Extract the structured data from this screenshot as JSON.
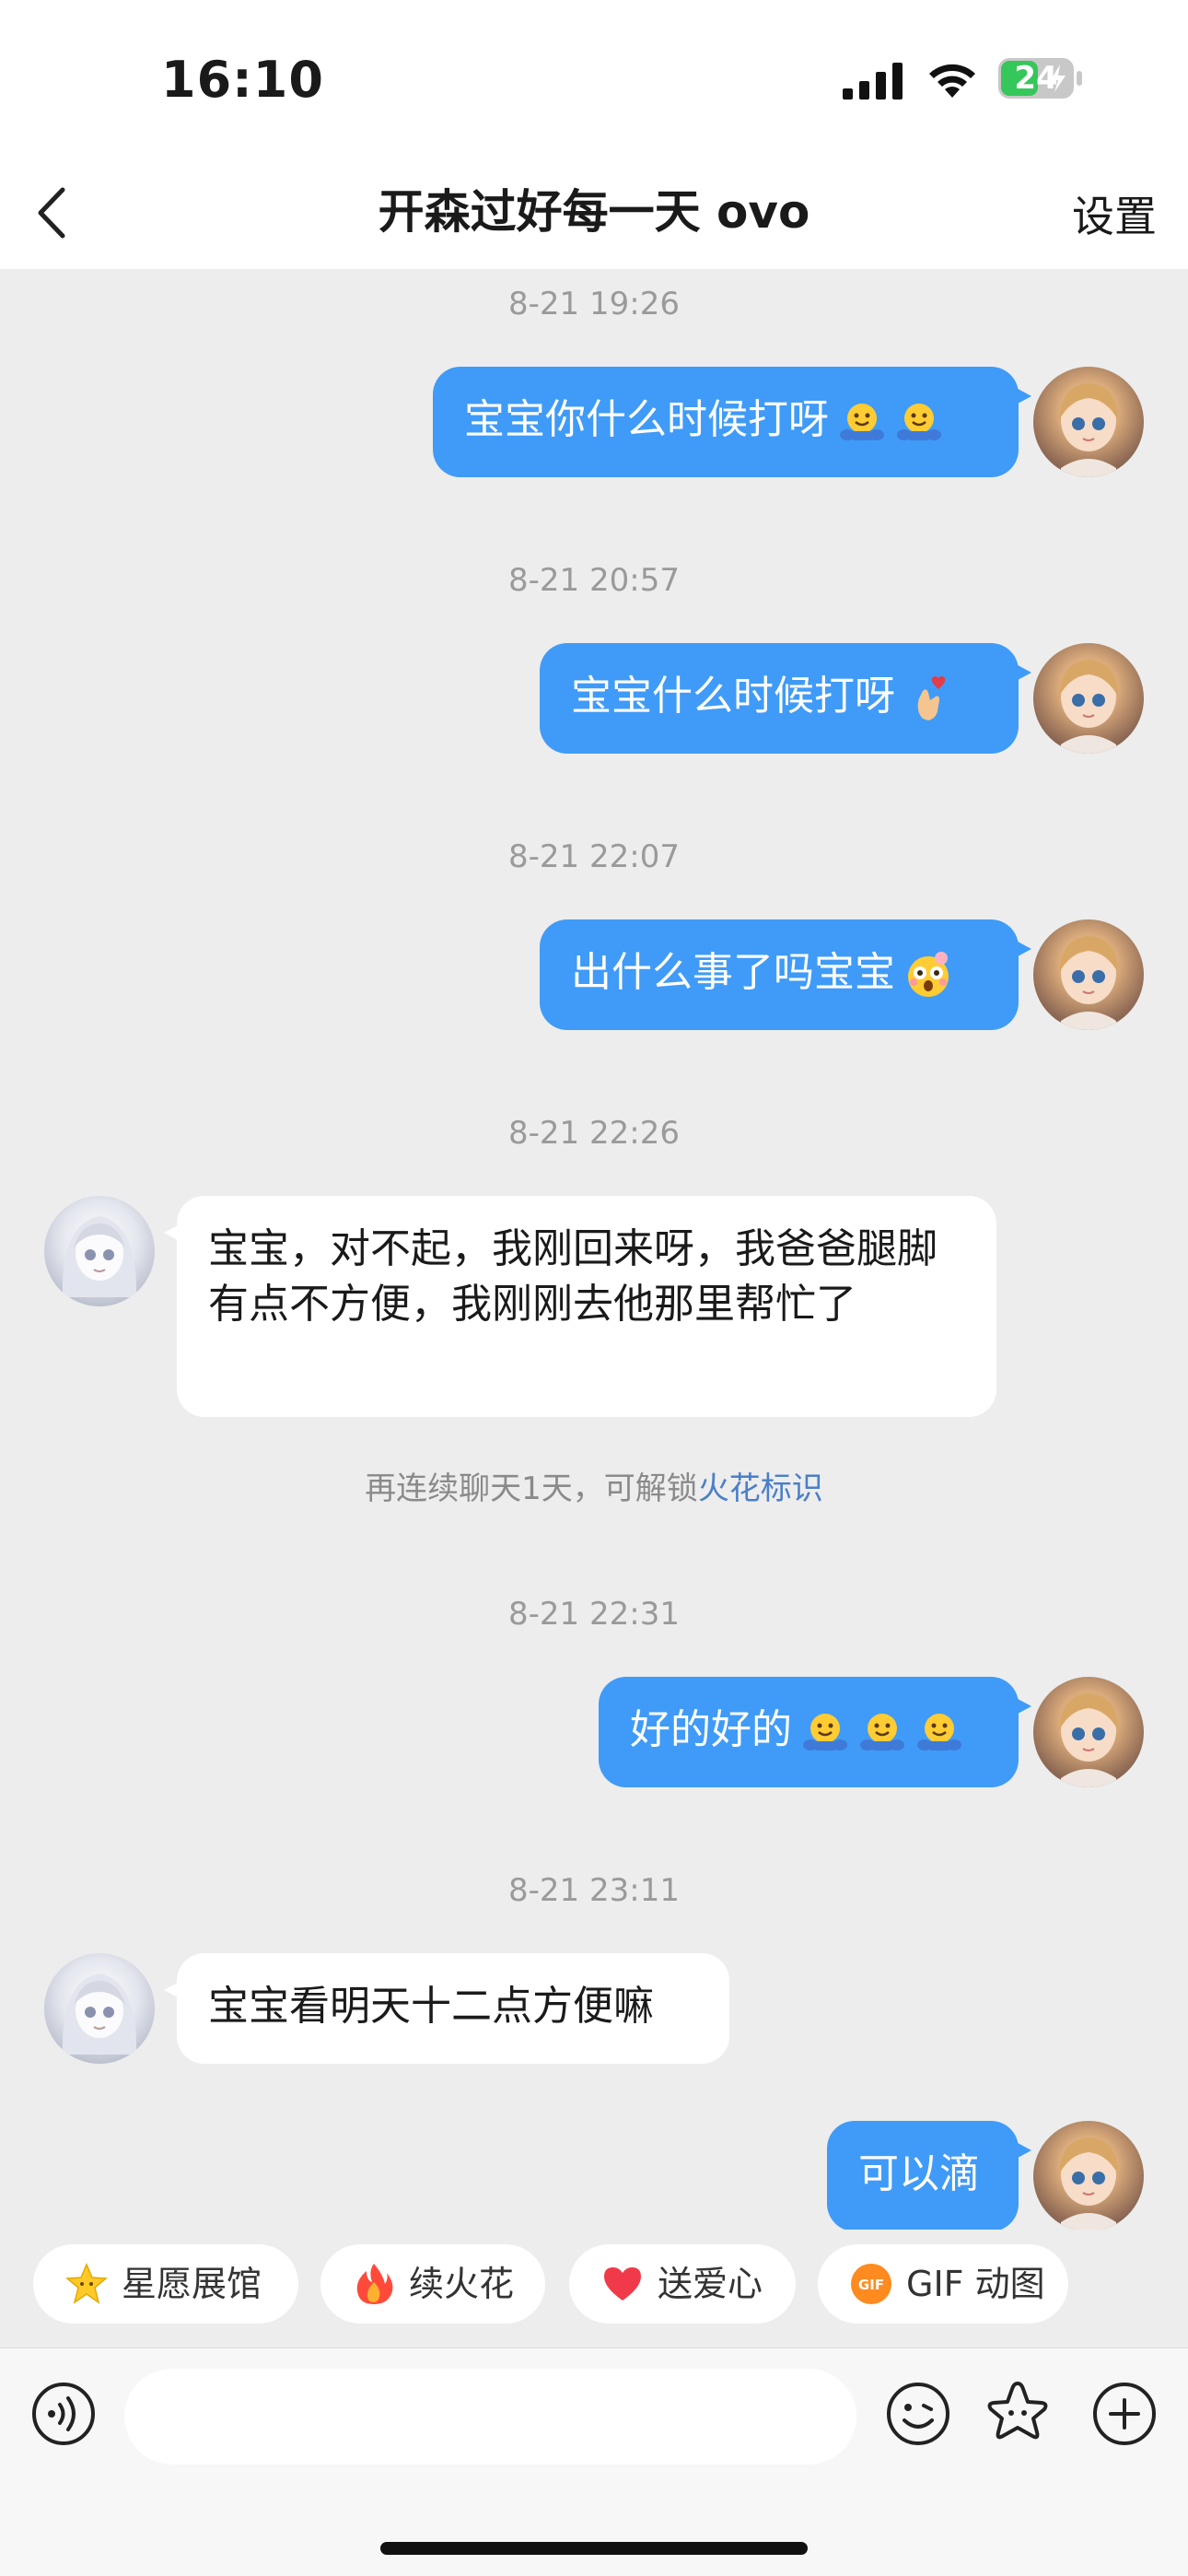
{
  "status_bar": {
    "time": "16:10",
    "battery": "24"
  },
  "nav": {
    "title": "开森过好每一天 ovo",
    "settings_label": "设置"
  },
  "messages": [
    {
      "time": "8-21 19:26",
      "text": "宝宝你什么时候打呀"
    },
    {
      "time": "8-21 20:57",
      "text": "宝宝什么时候打呀"
    },
    {
      "time": "8-21 22:07",
      "text": "出什么事了吗宝宝"
    },
    {
      "time": "8-21 22:26",
      "text": "宝宝，对不起，我刚回来呀，我爸爸腿脚有点不方便，我刚刚去他那里帮忙了"
    },
    {
      "time": "8-21 22:31",
      "text": "好的好的"
    },
    {
      "time": "8-21 23:11",
      "text": "宝宝看明天十二点方便嘛"
    },
    {
      "time": "",
      "text": "可以滴"
    }
  ],
  "notice": {
    "text": "再连续聊天1天，可解锁",
    "link": "火花标识"
  },
  "quick_actions": [
    {
      "label": "星愿展馆",
      "icon": "star-icon"
    },
    {
      "label": "续火花",
      "icon": "flame-icon"
    },
    {
      "label": "送爱心",
      "icon": "heart-icon"
    },
    {
      "label": "GIF 动图",
      "icon": "gif-icon"
    }
  ],
  "input": {
    "placeholder": ""
  },
  "colors": {
    "outgoing_bubble": "#3f9bf7",
    "chat_bg": "#ededed",
    "link": "#4a7fc8"
  }
}
